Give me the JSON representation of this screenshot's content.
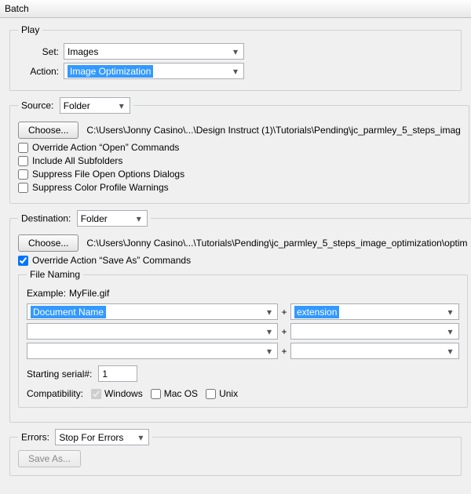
{
  "window": {
    "title": "Batch"
  },
  "play": {
    "legend": "Play",
    "set_label": "Set:",
    "set_value": "Images",
    "action_label": "Action:",
    "action_value": "Image Optimization"
  },
  "source": {
    "legend_label": "Source:",
    "legend_value": "Folder",
    "choose_label": "Choose...",
    "path": "C:\\Users\\Jonny Casino\\...\\Design Instruct (1)\\Tutorials\\Pending\\jc_parmley_5_steps_imag",
    "cb_override_open": "Override Action “Open” Commands",
    "cb_include_subfolders": "Include All Subfolders",
    "cb_suppress_file_open": "Suppress File Open Options Dialogs",
    "cb_suppress_color": "Suppress Color Profile Warnings"
  },
  "destination": {
    "legend_label": "Destination:",
    "legend_value": "Folder",
    "choose_label": "Choose...",
    "path": "C:\\Users\\Jonny Casino\\...\\Tutorials\\Pending\\jc_parmley_5_steps_image_optimization\\optim",
    "cb_override_saveas": "Override Action “Save As” Commands",
    "file_naming": {
      "legend": "File Naming",
      "example_label": "Example:",
      "example_value": "MyFile.gif",
      "field1": "Document Name",
      "field2": "extension",
      "field3": "",
      "field4": "",
      "field5": "",
      "field6": "",
      "plus": "+",
      "starting_serial_label": "Starting serial#:",
      "starting_serial_value": "1",
      "compat_label": "Compatibility:",
      "compat_windows": "Windows",
      "compat_macos": "Mac OS",
      "compat_unix": "Unix"
    }
  },
  "errors": {
    "legend_label": "Errors:",
    "legend_value": "Stop For Errors",
    "save_as_label": "Save As..."
  }
}
